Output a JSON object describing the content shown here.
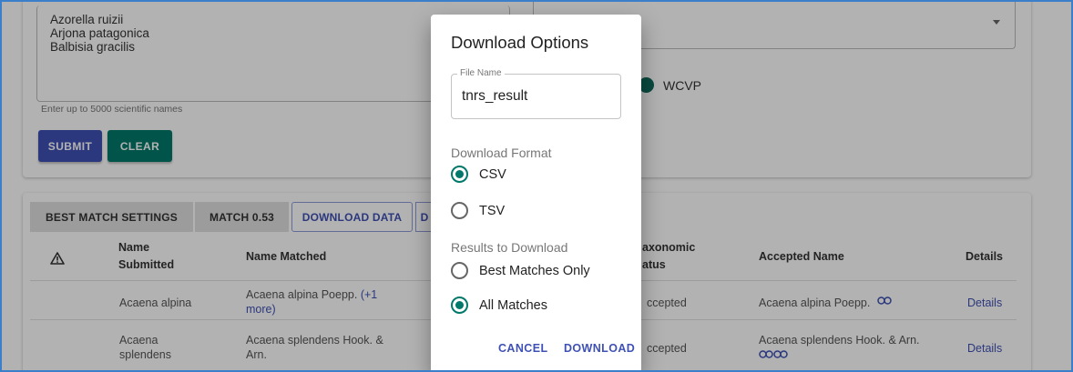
{
  "form": {
    "names": [
      "Azorella ruizii",
      "Arjona patagonica",
      "Balbisia gracilis"
    ],
    "helper": "Enter up to 5000 scientific names",
    "submit_label": "SUBMIT",
    "clear_label": "CLEAR",
    "source_label": "WCVP"
  },
  "results": {
    "tabs": [
      "BEST MATCH SETTINGS",
      "MATCH 0.53",
      "DOWNLOAD DATA",
      "D"
    ],
    "columns": {
      "name_submitted": "Name\nSubmitted",
      "name_matched": "Name Matched",
      "taxonomic_status": "axonomic\natus",
      "accepted_name": "Accepted Name",
      "details": "Details"
    },
    "rows": [
      {
        "name_submitted": "Acaena alpina",
        "name_matched": "Acaena alpina Poepp.",
        "more": "(+1\nmore)",
        "status": "ccepted",
        "accepted_name": "Acaena alpina Poepp.",
        "details": "Details"
      },
      {
        "name_submitted": "Acaena\nsplendens",
        "name_matched": "Acaena splendens Hook. &\nArn.",
        "status": "ccepted",
        "accepted_name": "Acaena splendens Hook. & Arn.",
        "details": "Details"
      }
    ]
  },
  "dialog": {
    "title": "Download Options",
    "file_name_label": "File Name",
    "file_name_value": "tnrs_result",
    "format_label": "Download Format",
    "formats": [
      "CSV",
      "TSV"
    ],
    "selected_format": "CSV",
    "results_label": "Results to Download",
    "result_options": [
      "Best Matches Only",
      "All Matches"
    ],
    "selected_result": "All Matches",
    "cancel_label": "CANCEL",
    "download_label": "DOWNLOAD"
  },
  "colors": {
    "primary": "#3f51b5",
    "secondary": "#00796b",
    "source_dot": "#0f6b5e"
  },
  "icons": {
    "warning": "warning-triangle-icon",
    "link": "link-icon",
    "dropdown": "chevron-down-icon"
  }
}
